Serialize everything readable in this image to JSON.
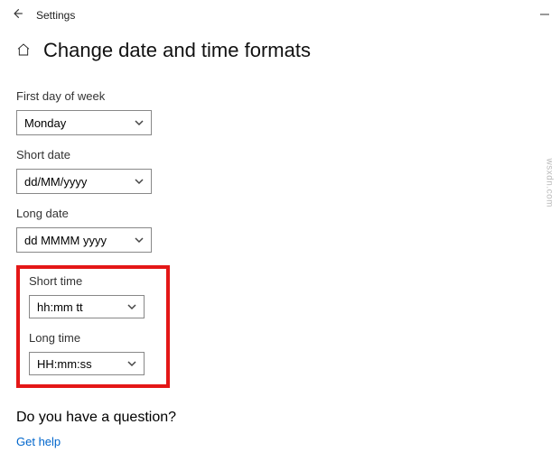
{
  "window": {
    "title": "Settings"
  },
  "page": {
    "title": "Change date and time formats"
  },
  "fields": {
    "first_day_of_week": {
      "label": "First day of week",
      "value": "Monday"
    },
    "short_date": {
      "label": "Short date",
      "value": "dd/MM/yyyy"
    },
    "long_date": {
      "label": "Long date",
      "value": "dd MMMM yyyy"
    },
    "short_time": {
      "label": "Short time",
      "value": "hh:mm tt"
    },
    "long_time": {
      "label": "Long time",
      "value": "HH:mm:ss"
    }
  },
  "footer": {
    "question": "Do you have a question?",
    "help_link": "Get help"
  },
  "watermark": "wsxdn.com",
  "highlight_color": "#e41717"
}
